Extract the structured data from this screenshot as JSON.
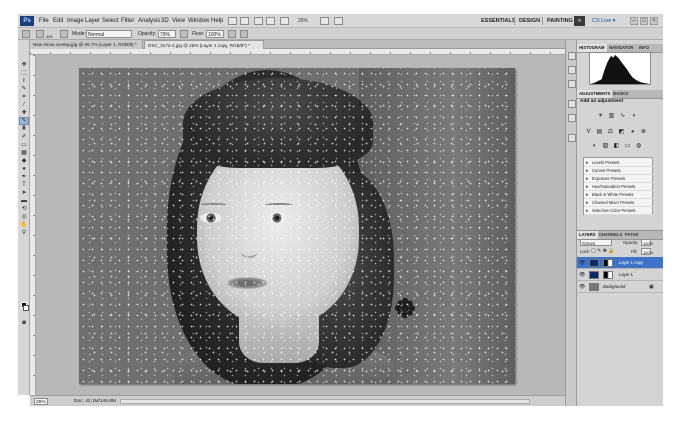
{
  "app": {
    "logo": "Ps"
  },
  "menu": {
    "items": [
      "File",
      "Edit",
      "Image",
      "Layer",
      "Select",
      "Filter",
      "Analysis",
      "3D",
      "View",
      "Window",
      "Help"
    ],
    "zoom": "25%",
    "workspaces": [
      "ESSENTIALS",
      "DESIGN",
      "PAINTING"
    ],
    "more": "»",
    "cs_live": "CS Live ▾",
    "window_controls": [
      "–",
      "□",
      "×"
    ]
  },
  "options": {
    "brush_size": "400",
    "mode_label": "Mode:",
    "mode_value": "Normal",
    "opacity_label": "Opacity:",
    "opacity_value": "79%",
    "flow_label": "Flow:",
    "flow_value": "100%"
  },
  "tabs": [
    {
      "label": "New snow overlay.jpg @ 66.7% (Layer 1, RGB/8) *",
      "active": false
    },
    {
      "label": "DSC_3172-2.jpg @ 25% (Layer 1 copy, RGB/8*) *",
      "active": true
    }
  ],
  "status": {
    "zoom": "25%",
    "doc": "Doc: 42.1M/149.8M"
  },
  "panels": {
    "histogram_tabs": [
      "HISTOGRAM",
      "NAVIGATOR",
      "INFO"
    ],
    "adjustments_tabs": [
      "ADJUSTMENTS",
      "MASKS"
    ],
    "adjustments_title": "Add an adjustment",
    "presets": [
      "Levels Presets",
      "Curves Presets",
      "Exposure Presets",
      "Hue/Saturation Presets",
      "Black & White Presets",
      "Channel Mixer Presets",
      "Selective Color Presets"
    ],
    "layers_tabs": [
      "LAYERS",
      "CHANNELS",
      "PATHS"
    ],
    "blend_mode": "Screen",
    "opacity_label": "Opacity:",
    "opacity_value": "100%",
    "lock_label": "Lock:",
    "fill_label": "Fill:",
    "fill_value": "100%",
    "layers": [
      {
        "name": "Layer 1 copy",
        "selected": true
      },
      {
        "name": "Layer 1",
        "selected": false
      },
      {
        "name": "Background",
        "selected": false
      }
    ]
  },
  "colors": {
    "selection": "#3f73c8",
    "foreground": "#000000",
    "background": "#ffffff",
    "workspace_highlight": "#1f4aa8"
  }
}
